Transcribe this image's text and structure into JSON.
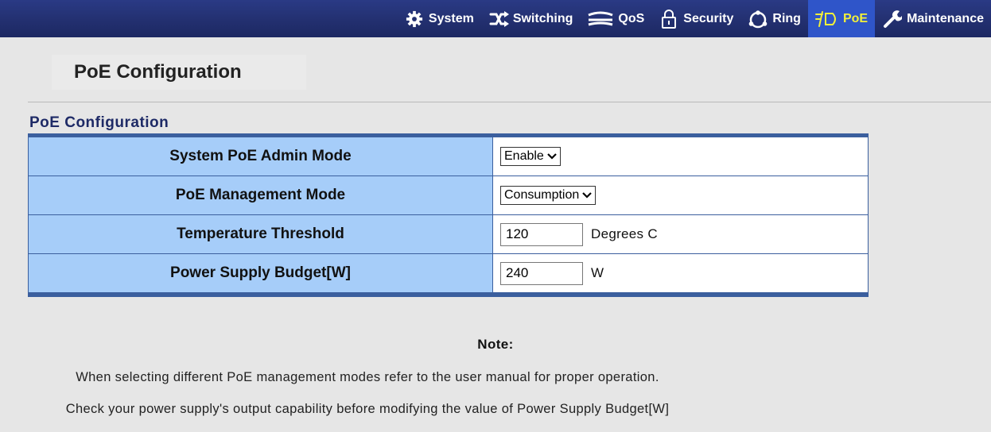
{
  "nav": {
    "items": [
      {
        "label": "System",
        "icon": "gear-icon"
      },
      {
        "label": "Switching",
        "icon": "switching-arrows-icon"
      },
      {
        "label": "QoS",
        "icon": "qos-lines-icon"
      },
      {
        "label": "Security",
        "icon": "lock-icon"
      },
      {
        "label": "Ring",
        "icon": "ring-icon"
      },
      {
        "label": "PoE",
        "icon": "poe-plug-icon",
        "active": true
      },
      {
        "label": "Maintenance",
        "icon": "wrench-icon"
      }
    ],
    "colors": {
      "bar": "#233070",
      "active_bg": "#2f55c9",
      "active_text": "#f1ef3a"
    }
  },
  "page": {
    "title": "PoE Configuration",
    "section_title": "PoE Configuration"
  },
  "config": {
    "rows": [
      {
        "label": "System PoE Admin Mode",
        "control": "select",
        "value": "Enable"
      },
      {
        "label": "PoE Management Mode",
        "control": "select",
        "value": "Consumption"
      },
      {
        "label": "Temperature Threshold",
        "control": "input",
        "value": "120",
        "unit": "Degrees C"
      },
      {
        "label": "Power Supply Budget[W]",
        "control": "input",
        "value": "240",
        "unit": "W"
      }
    ],
    "colors": {
      "label_bg": "#a6cdf9",
      "border": "#3b5f9e"
    }
  },
  "notes": {
    "title": "Note:",
    "lines": [
      "When selecting different PoE management modes refer to the user manual for proper operation.",
      "Check your power supply's output capability before modifying the value of Power Supply Budget[W]"
    ]
  }
}
